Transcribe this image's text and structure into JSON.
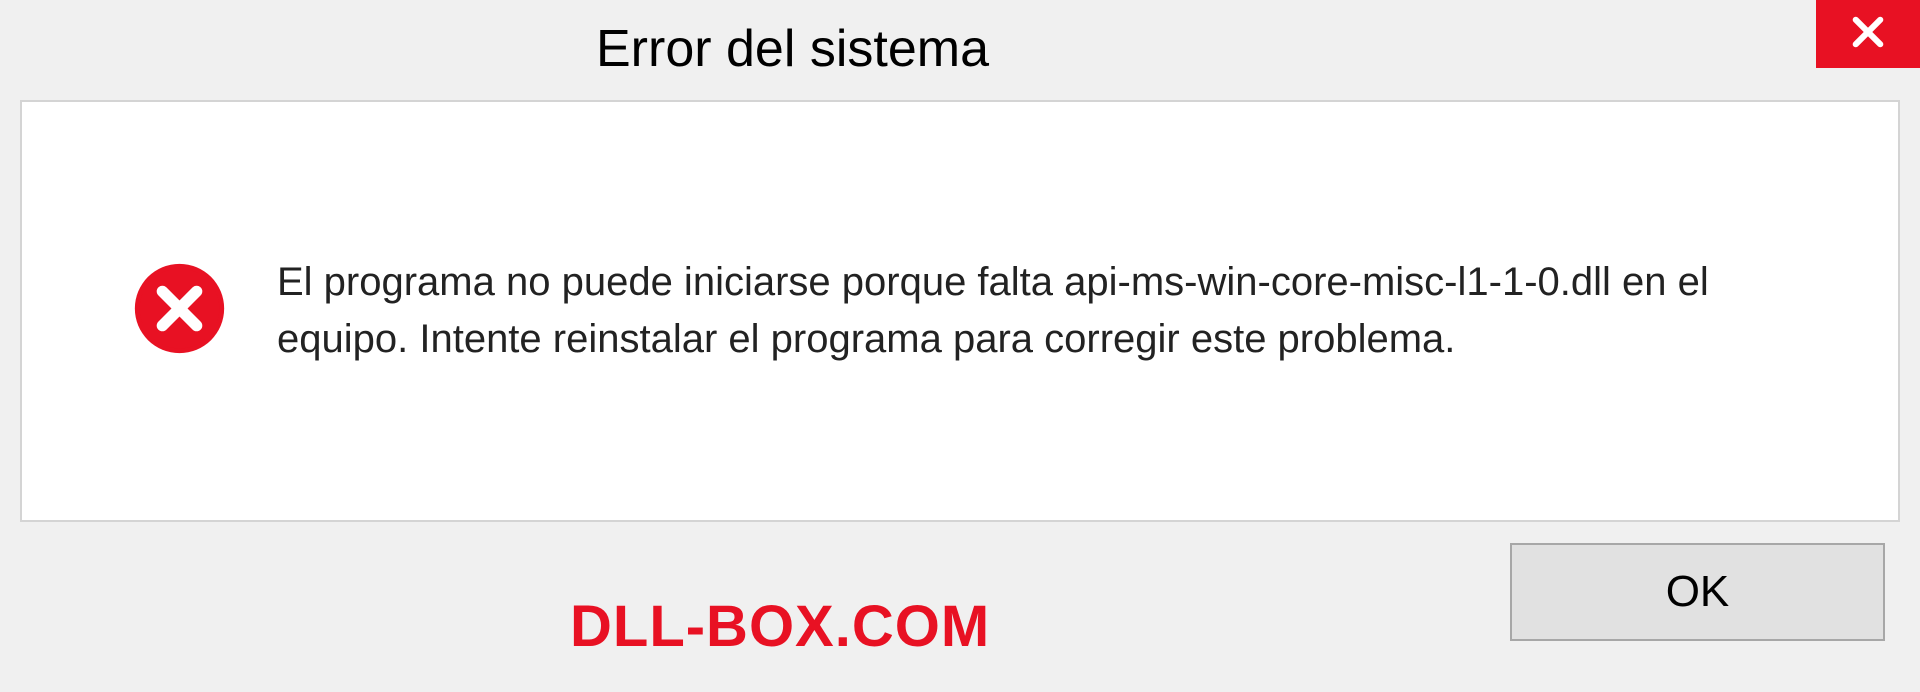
{
  "dialog": {
    "title": "Error del sistema",
    "message": "El programa no puede iniciarse porque falta api-ms-win-core-misc-l1-1-0.dll en el equipo. Intente reinstalar el programa para corregir este problema.",
    "ok_label": "OK"
  },
  "watermark": "DLL-BOX.COM"
}
